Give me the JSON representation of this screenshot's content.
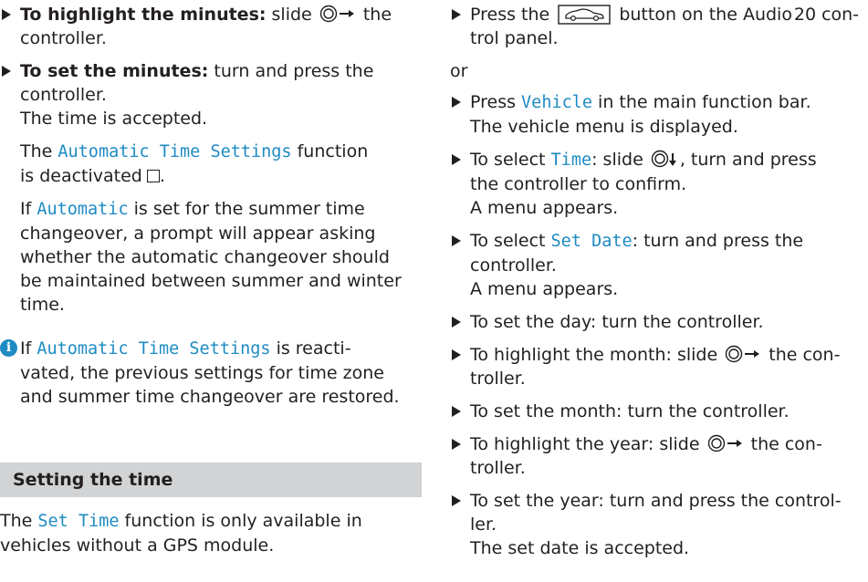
{
  "left": {
    "step1": {
      "bold": "To highlight the minutes:",
      "pre": " slide",
      "post": " the",
      "line2": "controller."
    },
    "step2": {
      "bold": "To set the minutes:",
      "post": " turn and press the",
      "line2": "controller.",
      "line3": "The time is accepted.",
      "p1_pre": "The",
      "p1_mono": "Automatic Time Settings",
      "p1_post": " function",
      "p1_line2": "is deactivated",
      "p1_end": ".",
      "p2_pre": "If ",
      "p2_mono": "Automatic",
      "p2_post": " is set for the summer time",
      "p2_l2": "changeover, a prompt will appear asking",
      "p2_l3": "whether the automatic changeover should",
      "p2_l4": "be maintained between summer and winter",
      "p2_l5": "time."
    },
    "info": {
      "pre": "If ",
      "mono": "Automatic Time Settings",
      "post": " is reacti-",
      "l2": "vated, the previous settings for time zone",
      "l3": "and summer time changeover are restored."
    },
    "heading": "Setting the time",
    "tail_pre": "The ",
    "tail_mono": "Set Time",
    "tail_post": " function is only available in",
    "tail_l2": "vehicles without a GPS module."
  },
  "right": {
    "s1_pre": "Press the",
    "s1_post": " button on the Audio 20 con-",
    "s1_l2": "trol panel.",
    "or": "or",
    "s2_pre": "Press ",
    "s2_mono": "Vehicle",
    "s2_post": " in the main function bar.",
    "s2_l2": "The vehicle menu is displayed.",
    "s3_pre": "To select ",
    "s3_mono": "Time",
    "s3_mid": ": slide",
    "s3_post": ", turn and press",
    "s3_l2": "the controller to confirm.",
    "s3_l3": "A menu appears.",
    "s4_pre": "To select ",
    "s4_mono": "Set Date",
    "s4_post": ": turn and press the",
    "s4_l2": "controller.",
    "s4_l3": "A menu appears.",
    "s5": "To set the day: turn the controller.",
    "s6_pre": "To highlight the month: slide",
    "s6_post": " the con-",
    "s6_l2": "troller.",
    "s7": "To set the month: turn the controller.",
    "s8_pre": "To highlight the year: slide",
    "s8_post": " the con-",
    "s8_l2": "troller.",
    "s9": "To set the year: turn and press the control-",
    "s9_l2": "ler.",
    "s9_l3": "The set date is accepted."
  },
  "colors": {
    "accent": "#1e8bc3",
    "text": "#231f20",
    "heading_bg": "#d1d3d4"
  },
  "icons": [
    "triangle-bullet-icon",
    "controller-slide-right-icon",
    "controller-slide-down-icon",
    "checkbox-empty-icon",
    "info-icon",
    "vehicle-button-icon"
  ]
}
